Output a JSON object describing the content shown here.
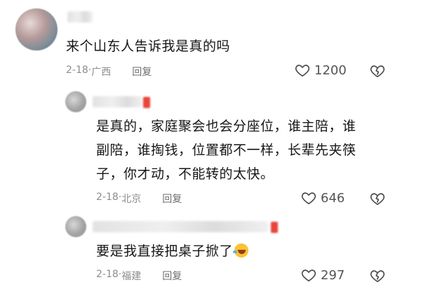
{
  "comments": [
    {
      "text": "来个山东人告诉我是真的吗",
      "date": "2-18",
      "location": "广西",
      "reply_label": "回复",
      "likes": "1200"
    },
    {
      "text_lines": [
        "是真的，家庭聚会也会分座位，谁主陪，谁",
        "副陪，谁掏钱，位置都不一样，长辈先夹筷",
        "子，你才动，不能转的太快。"
      ],
      "date": "2-18",
      "location": "北京",
      "reply_label": "回复",
      "likes": "646"
    },
    {
      "text": "要是我直接把桌子掀了",
      "emoji": "rofl-emoji",
      "date": "2-18",
      "location": "福建",
      "reply_label": "回复",
      "likes": "297"
    }
  ],
  "colors": {
    "accent": "#e9433a",
    "meta": "#8d8d8d",
    "icon": "#4a4a4a"
  }
}
